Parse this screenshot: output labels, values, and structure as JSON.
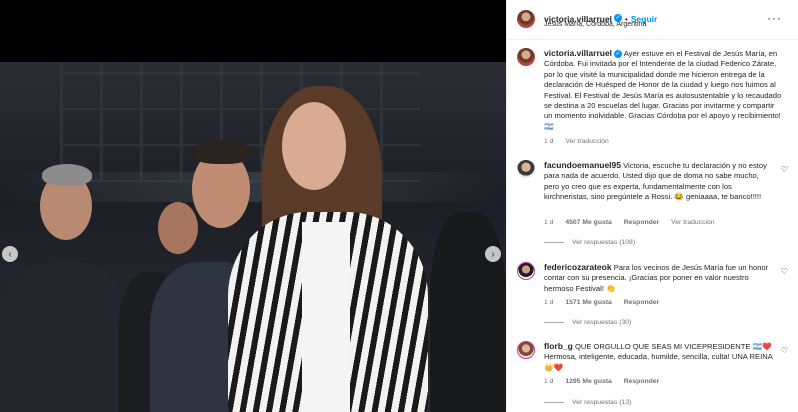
{
  "post": {
    "username": "victoria.villarruel",
    "follow_label": "Seguir",
    "location": "Jesús María, Córdoba, Argentina",
    "more_label": "···"
  },
  "caption": {
    "username": "victoria.villarruel",
    "text": "Ayer estuve en el Festival de Jesús María, en Córdoba. Fui invitada por el Intendente de la ciudad Federico Zárate, por lo que visité la municipalidad donde me hicieron entrega de la declaración de Huésped de Honor de la ciudad y luego nos fuimos al Festival. El Festival de Jesús María es autosustentable y lo recaudado se destina a 20 escuelas del lugar. Gracias por invitarme y compartir un momento inolvidable. Gracias Córdoba por el apoyo y recibimiento! 🇦🇷",
    "time": "1 d",
    "translate_label": "Ver traducción"
  },
  "comments": [
    {
      "username": "facundoemanuel95",
      "text": "Victoria, escuche tu declaración y no estoy para nada de acuerdo. Usted dijo que de doma no sabe mucho, pero yo creo que es experta, fundamentalmente con los kirchneristas, sino pregúntele a Rossi. 😂 geniaaaa, te banco!!!!!",
      "time": "1 d",
      "likes": "4507 Me gusta",
      "reply_label": "Responder",
      "translate_label": "Ver traducción",
      "replies_label": "Ver respuestas (108)"
    },
    {
      "username": "federicozarateok",
      "text": "Para los vecinos de Jesús María fue un honor contar con su presencia. ¡Gracias por poner en valor nuestro hermoso Festival! 👏",
      "time": "1 d",
      "likes": "1571 Me gusta",
      "reply_label": "Responder",
      "translate_label": "",
      "replies_label": "Ver respuestas (30)"
    },
    {
      "username": "florb_g",
      "text": "QUE ORGULLO QUE SEAS MI VICEPRESIDENTE 🇦🇷❤️ Hermosa, inteligente, educada, humilde, sencilla, culta! UNA REINA👑❤️",
      "time": "1 d",
      "likes": "1295 Me gusta",
      "reply_label": "Responder",
      "translate_label": "",
      "replies_label": "Ver respuestas (13)"
    }
  ],
  "icons": {
    "verified": "verified-badge-icon",
    "heart": "heart-icon",
    "nav_prev": "chevron-left-icon",
    "nav_next": "chevron-right-icon"
  },
  "colors": {
    "link_blue": "#0095f6",
    "secondary_text": "#737373"
  }
}
